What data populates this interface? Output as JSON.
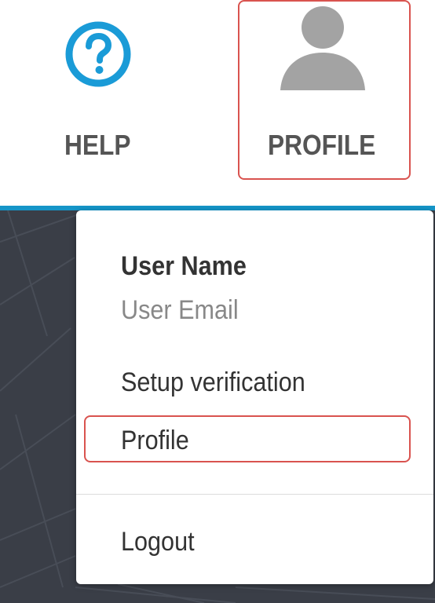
{
  "topnav": {
    "help": {
      "label": "HELP",
      "icon": "help-question-icon"
    },
    "profile": {
      "label": "PROFILE",
      "icon": "user-avatar-icon"
    }
  },
  "colors": {
    "accent": "#1595c8",
    "help_icon": "#1a9bd7",
    "highlight_border": "#d9534f",
    "dark_background": "#3a3e47"
  },
  "dropdown": {
    "user_name": "User Name",
    "user_email": "User Email",
    "setup_verification": "Setup verification",
    "profile": "Profile",
    "logout": "Logout"
  }
}
